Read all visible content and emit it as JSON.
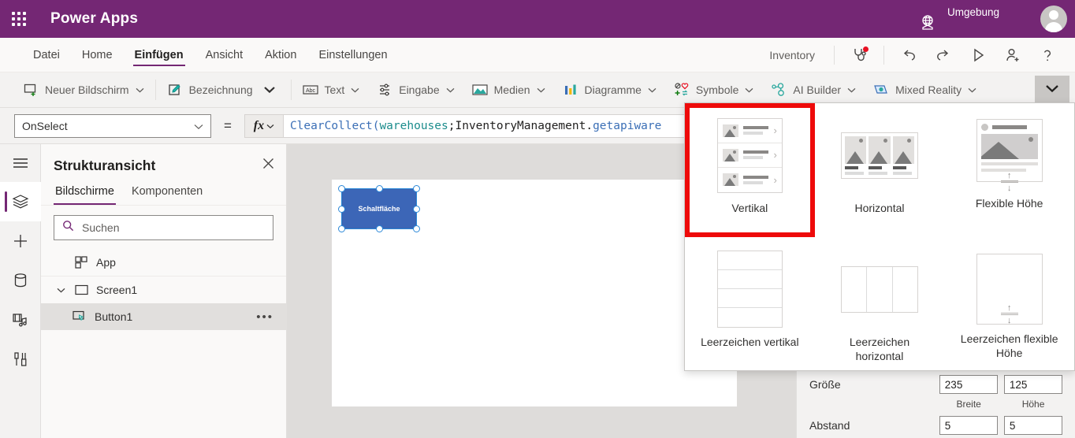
{
  "topbar": {
    "waffle_icon": "app-launcher-icon",
    "brand": "Power Apps",
    "globe_icon": "environment-globe-icon",
    "environment_label": "Umgebung",
    "avatar_icon": "user-avatar"
  },
  "menubar": {
    "items": [
      {
        "label": "Datei",
        "active": false
      },
      {
        "label": "Home",
        "active": false
      },
      {
        "label": "Einfügen",
        "active": true
      },
      {
        "label": "Ansicht",
        "active": false
      },
      {
        "label": "Aktion",
        "active": false
      },
      {
        "label": "Einstellungen",
        "active": false
      }
    ],
    "app_name": "Inventory",
    "icons": [
      {
        "name": "app-checker-icon",
        "badge": true
      },
      {
        "name": "undo-icon",
        "badge": false
      },
      {
        "name": "redo-icon",
        "badge": false
      },
      {
        "name": "play-preview-icon",
        "badge": false
      },
      {
        "name": "share-person-icon",
        "badge": false
      },
      {
        "name": "help-icon",
        "badge": false
      }
    ]
  },
  "ribbon": {
    "items": [
      {
        "label": "Neuer Bildschirm",
        "icon": "new-screen-icon",
        "chevron": true
      },
      {
        "label": "Bezeichnung",
        "icon": "label-pencil-icon",
        "chevron": true
      },
      {
        "label": "Text",
        "icon": "text-abc-icon",
        "chevron": true
      },
      {
        "label": "Eingabe",
        "icon": "input-sliders-icon",
        "chevron": true
      },
      {
        "label": "Medien",
        "icon": "media-image-icon",
        "chevron": true
      },
      {
        "label": "Diagramme",
        "icon": "charts-bar-icon",
        "chevron": true
      },
      {
        "label": "Symbole",
        "icon": "symbols-icon",
        "chevron": true
      },
      {
        "label": "AI Builder",
        "icon": "ai-builder-icon",
        "chevron": true
      },
      {
        "label": "Mixed Reality",
        "icon": "mixed-reality-icon",
        "chevron": true
      }
    ],
    "overflow_icon": "chevron-down-icon"
  },
  "formula_bar": {
    "property": "OnSelect",
    "equals": "=",
    "fx_label": "fx",
    "formula_tokens": [
      {
        "text": "ClearCollect(",
        "type": "fn"
      },
      {
        "text": "warehouses",
        "type": "var"
      },
      {
        "text": ";InventoryManagement.",
        "type": "plain"
      },
      {
        "text": "getapiware",
        "type": "fn"
      }
    ]
  },
  "rail": {
    "items": [
      {
        "name": "hamburger-menu-icon",
        "active": false
      },
      {
        "name": "tree-view-layers-icon",
        "active": true
      },
      {
        "name": "insert-plus-icon",
        "active": false
      },
      {
        "name": "data-database-icon",
        "active": false
      },
      {
        "name": "media-library-icon",
        "active": false
      },
      {
        "name": "advanced-tools-icon",
        "active": false
      }
    ]
  },
  "tree_panel": {
    "title": "Strukturansicht",
    "close_icon": "close-icon",
    "tabs": [
      {
        "label": "Bildschirme",
        "active": true
      },
      {
        "label": "Komponenten",
        "active": false
      }
    ],
    "search": {
      "placeholder": "Suchen",
      "value": "",
      "icon": "search-icon"
    },
    "nodes": [
      {
        "label": "App",
        "icon": "app-icon",
        "indent": 0,
        "caret": "",
        "selected": false,
        "more": false
      },
      {
        "label": "Screen1",
        "icon": "screen-icon",
        "indent": 0,
        "caret": "expanded",
        "selected": false,
        "more": false
      },
      {
        "label": "Button1",
        "icon": "button-icon",
        "indent": 1,
        "caret": "",
        "selected": true,
        "more": true
      }
    ],
    "more_icon": "more-ellipsis-icon"
  },
  "canvas": {
    "selected_control": {
      "label": "Schaltfläche",
      "fill_color": "#3c66b7",
      "selection_color": "#2b88d8"
    }
  },
  "properties": {
    "rows": [
      {
        "name": "Größe",
        "value1": "235",
        "value2": "125",
        "sub1": "Breite",
        "sub2": "Höhe"
      },
      {
        "name": "Abstand",
        "value1": "5",
        "value2": "5",
        "sub1": "",
        "sub2": ""
      }
    ]
  },
  "flyout": {
    "highlight_color": "#ee0a0a",
    "items": [
      {
        "label": "Vertikal",
        "thumb": "gallery-vertical-thumb",
        "highlighted": true
      },
      {
        "label": "Horizontal",
        "thumb": "gallery-horizontal-thumb",
        "highlighted": false
      },
      {
        "label": "Flexible Höhe",
        "thumb": "gallery-flexible-height-thumb",
        "highlighted": false
      },
      {
        "label": "Leerzeichen vertikal",
        "thumb": "blank-vertical-thumb",
        "highlighted": false
      },
      {
        "label": "Leerzeichen horizontal",
        "thumb": "blank-horizontal-thumb",
        "highlighted": false
      },
      {
        "label": "Leerzeichen flexible Höhe",
        "thumb": "blank-flexible-height-thumb",
        "highlighted": false
      }
    ]
  },
  "colors": {
    "brand_purple": "#742774",
    "accent_blue": "#3c66b7",
    "alert_red": "#e81123"
  }
}
